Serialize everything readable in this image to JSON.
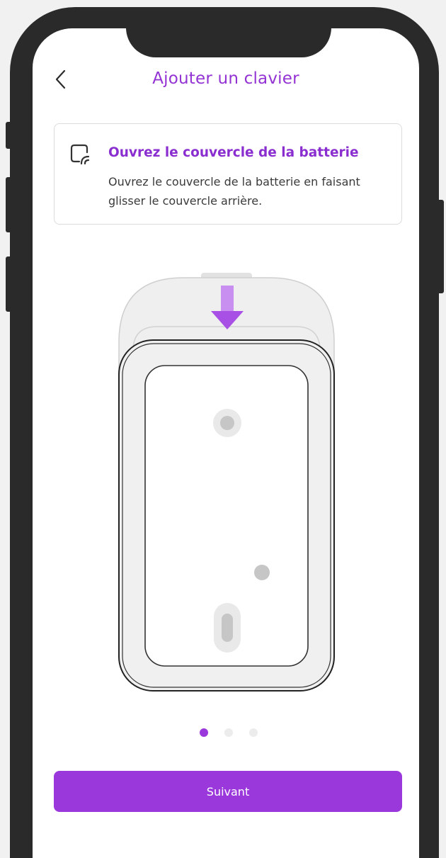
{
  "header": {
    "title": "Ajouter un clavier",
    "back_icon": "chevron-left-icon"
  },
  "instruction_card": {
    "icon": "battery-cover-icon",
    "heading": "Ouvrez le couvercle de la batterie",
    "body": "Ouvrez le couvercle de la batterie en faisant glisser le couvercle arrière."
  },
  "illustration": {
    "subject": "keypad-back-cover-illustration",
    "arrow_icon": "arrow-down-icon"
  },
  "pagination": {
    "total": 3,
    "active_index": 0
  },
  "footer": {
    "next_label": "Suivant"
  },
  "colors": {
    "accent": "#9b38dc",
    "title": "#9333d4",
    "frame": "#2a2a2a"
  }
}
